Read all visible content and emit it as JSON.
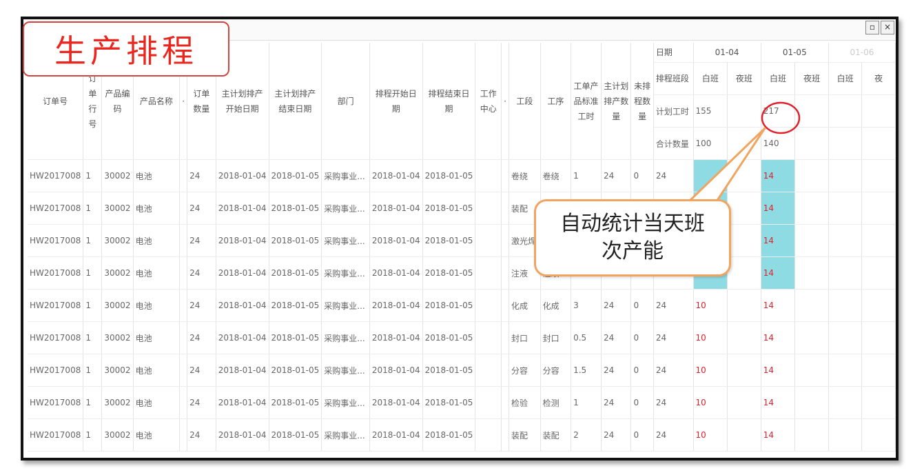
{
  "title": "生产排程",
  "callout": {
    "line1": "自动统计当天班",
    "line2": "次产能"
  },
  "columns": [
    "订单号",
    "订单行号",
    "产品编码",
    "产品名称",
    "·",
    "订单数量",
    "主计划排产开始日期",
    "主计划排产结束日期",
    "部门",
    "排程开始日期",
    "排程结束日期",
    "工作中心",
    "·",
    "工段",
    "工序",
    "工单产品标准工时",
    "主计划排产数量",
    "未排程数量"
  ],
  "schedule_labels": {
    "date": "日期",
    "shift": "排程班段",
    "plan_hours": "计划工时",
    "total_qty": "合计数量"
  },
  "dates": [
    "01-04",
    "01-05",
    "01-06"
  ],
  "shifts": [
    "白班",
    "夜班",
    "白班",
    "夜班",
    "白班",
    "夜"
  ],
  "plan_hours": {
    "d1": "155",
    "d2": "217"
  },
  "total_qty": {
    "d1": "100",
    "d2": "140"
  },
  "rows": [
    {
      "order": "HW2017008",
      "line": "1",
      "code": "30002",
      "name": "电池",
      "qty": "24",
      "ms": "2018-01-04",
      "me": "2018-01-05",
      "dept": "采购事业...",
      "ss": "2018-01-04",
      "se": "2018-01-05",
      "wc": "",
      "seg": "卷绕",
      "proc": "卷绕",
      "std": "1",
      "mqty": "24",
      "un": "0",
      "qty2": "24",
      "d1": "",
      "d2": "14"
    },
    {
      "order": "HW2017008",
      "line": "1",
      "code": "30002",
      "name": "电池",
      "qty": "24",
      "ms": "2018-01-04",
      "me": "2018-01-05",
      "dept": "采购事业...",
      "ss": "2018-01-04",
      "se": "2018-01-05",
      "wc": "",
      "seg": "装配",
      "proc": "",
      "std": "",
      "mqty": "",
      "un": "",
      "qty2": "",
      "d1": "",
      "d2": "14"
    },
    {
      "order": "HW2017008",
      "line": "1",
      "code": "30002",
      "name": "电池",
      "qty": "24",
      "ms": "2018-01-04",
      "me": "2018-01-05",
      "dept": "采购事业...",
      "ss": "2018-01-04",
      "se": "2018-01-05",
      "wc": "",
      "seg": "激光焊",
      "proc": "",
      "std": "",
      "mqty": "",
      "un": "",
      "qty2": "",
      "d1": "",
      "d2": "14"
    },
    {
      "order": "HW2017008",
      "line": "1",
      "code": "30002",
      "name": "电池",
      "qty": "24",
      "ms": "2018-01-04",
      "me": "2018-01-05",
      "dept": "采购事业...",
      "ss": "2018-01-04",
      "se": "2018-01-05",
      "wc": "",
      "seg": "注液",
      "proc": "注液",
      "std": "2",
      "mqty": "24",
      "un": "0",
      "qty2": "24",
      "d1": "10",
      "d2": "14"
    },
    {
      "order": "HW2017008",
      "line": "1",
      "code": "30002",
      "name": "电池",
      "qty": "24",
      "ms": "2018-01-04",
      "me": "2018-01-05",
      "dept": "采购事业...",
      "ss": "2018-01-04",
      "se": "2018-01-05",
      "wc": "",
      "seg": "化成",
      "proc": "化成",
      "std": "3",
      "mqty": "24",
      "un": "0",
      "qty2": "24",
      "d1": "10",
      "d2": "14"
    },
    {
      "order": "HW2017008",
      "line": "1",
      "code": "30002",
      "name": "电池",
      "qty": "24",
      "ms": "2018-01-04",
      "me": "2018-01-05",
      "dept": "采购事业...",
      "ss": "2018-01-04",
      "se": "2018-01-05",
      "wc": "",
      "seg": "封口",
      "proc": "封口",
      "std": "0.5",
      "mqty": "24",
      "un": "0",
      "qty2": "24",
      "d1": "10",
      "d2": "14"
    },
    {
      "order": "HW2017008",
      "line": "1",
      "code": "30002",
      "name": "电池",
      "qty": "24",
      "ms": "2018-01-04",
      "me": "2018-01-05",
      "dept": "采购事业...",
      "ss": "2018-01-04",
      "se": "2018-01-05",
      "wc": "",
      "seg": "分容",
      "proc": "分容",
      "std": "1.5",
      "mqty": "24",
      "un": "0",
      "qty2": "24",
      "d1": "10",
      "d2": "14"
    },
    {
      "order": "HW2017008",
      "line": "1",
      "code": "30002",
      "name": "电池",
      "qty": "24",
      "ms": "2018-01-04",
      "me": "2018-01-05",
      "dept": "采购事业...",
      "ss": "2018-01-04",
      "se": "2018-01-05",
      "wc": "",
      "seg": "检验",
      "proc": "检测",
      "std": "1",
      "mqty": "24",
      "un": "0",
      "qty2": "24",
      "d1": "10",
      "d2": "14"
    },
    {
      "order": "HW2017008",
      "line": "1",
      "code": "30002",
      "name": "电池",
      "qty": "24",
      "ms": "2018-01-04",
      "me": "2018-01-05",
      "dept": "采购事业...",
      "ss": "2018-01-04",
      "se": "2018-01-05",
      "wc": "",
      "seg": "装配",
      "proc": "装配",
      "std": "2",
      "mqty": "24",
      "un": "0",
      "qty2": "24",
      "d1": "10",
      "d2": "14"
    }
  ],
  "colors": {
    "accent_red": "#e0202a",
    "highlight_cyan": "#8fdbe3",
    "callout_border": "#f0a45f"
  }
}
